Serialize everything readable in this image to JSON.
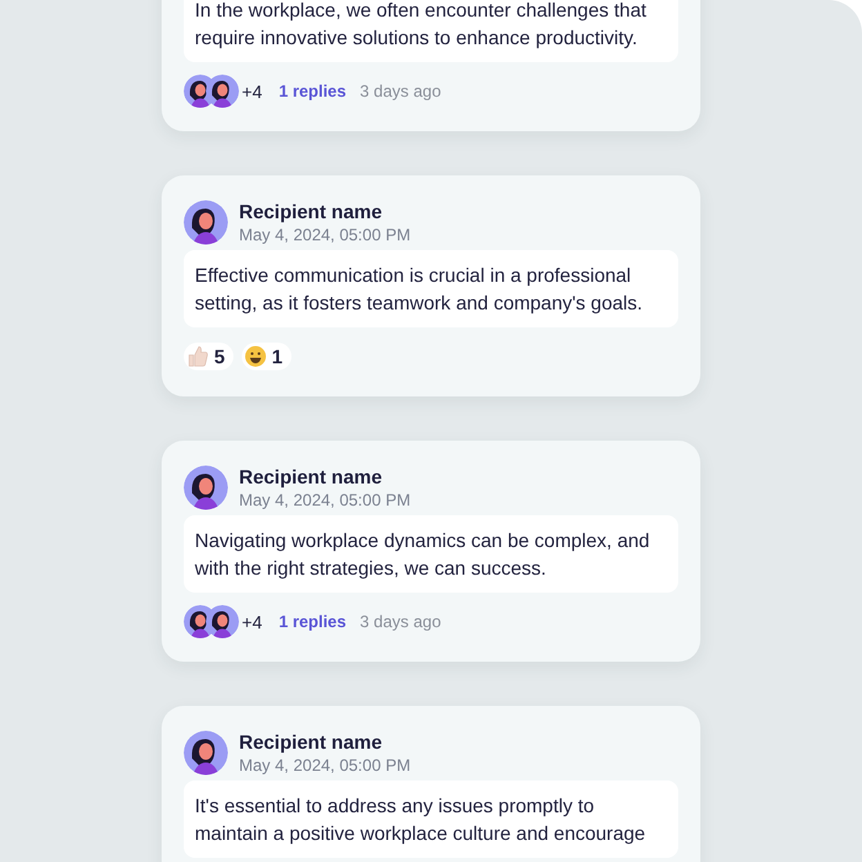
{
  "posts": [
    {
      "message": "In the workplace, we often encounter challenges that require innovative solutions to enhance productivity.",
      "footer": {
        "kind": "replies",
        "more": "+4",
        "replies": "1 replies",
        "time": "3 days ago"
      }
    },
    {
      "author": {
        "name": "Recipient name",
        "date": "May 4, 2024, 05:00 PM"
      },
      "message": "Effective communication is crucial in a professional setting, as it fosters teamwork and company's goals.",
      "footer": {
        "kind": "reactions",
        "reactions": [
          {
            "kind": "thumbs-up",
            "count": "5"
          },
          {
            "kind": "grin",
            "count": "1"
          }
        ]
      }
    },
    {
      "author": {
        "name": "Recipient name",
        "date": "May 4, 2024, 05:00 PM"
      },
      "message": "Navigating workplace dynamics can be complex, and with the right strategies, we can success.",
      "footer": {
        "kind": "replies",
        "more": "+4",
        "replies": "1 replies",
        "time": "3 days ago"
      }
    },
    {
      "author": {
        "name": "Recipient name",
        "date": "May 4, 2024, 05:00 PM"
      },
      "message": "It's essential to address any issues promptly to maintain a positive workplace culture and encourage"
    }
  ]
}
